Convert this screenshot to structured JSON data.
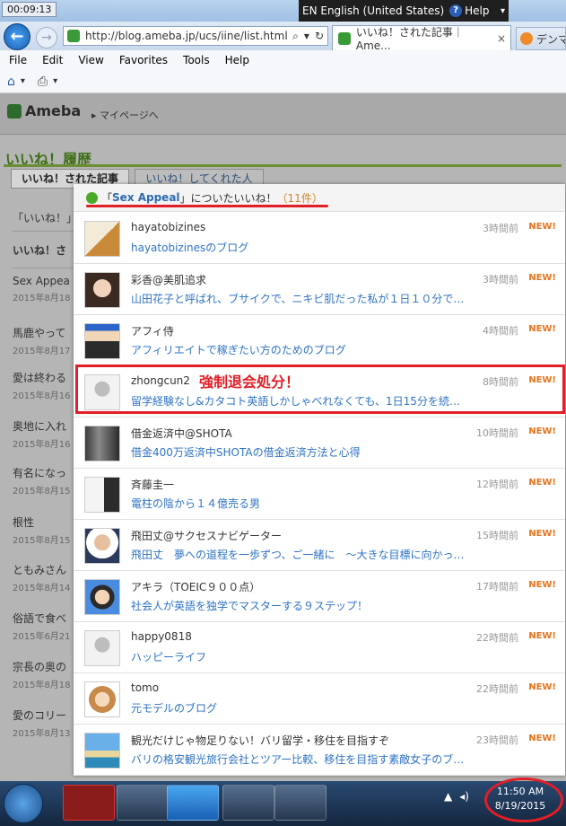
{
  "browser": {
    "timer": "00:09:13",
    "language": "EN English (United States)",
    "help": "Help",
    "address": "http://blog.ameba.jp/ucs/iine/list.html",
    "tabs": [
      {
        "label": "いいね！された記事｜Ame..."
      },
      {
        "label": "デンマ"
      }
    ],
    "menu": [
      "File",
      "Edit",
      "View",
      "Favorites",
      "Tools",
      "Help"
    ]
  },
  "ameba": {
    "logo": "Ameba",
    "mypage": "マイページへ",
    "page_title": "いいね！履歴",
    "tab_received": "いいね！された記事",
    "tab_given": "いいね！してくれた人"
  },
  "left_list": [
    {
      "title": "「いいね！」",
      "date": ""
    },
    {
      "title": "いいね！さ",
      "date": ""
    },
    {
      "title": "Sex Appea",
      "date": "2015年8月18"
    },
    {
      "title": "馬鹿やって",
      "date": "2015年8月17"
    },
    {
      "title": "愛は終わる",
      "date": "2015年8月16"
    },
    {
      "title": "奥地に入れ",
      "date": "2015年8月16"
    },
    {
      "title": "有名になっ",
      "date": "2015年8月15"
    },
    {
      "title": "根性",
      "date": "2015年8月15"
    },
    {
      "title": "ともみさん",
      "date": "2015年8月14"
    },
    {
      "title": "俗語で食べ",
      "date": "2015年6月21"
    },
    {
      "title": "宗長の奥の",
      "date": "2015年8月18"
    },
    {
      "title": "愛のコリー",
      "date": "2015年8月13"
    }
  ],
  "popup": {
    "header_prefix": "「",
    "article": "Sex Appeal",
    "header_suffix": "」についたいいね！",
    "count": "（11件）",
    "items": [
      {
        "name": "hayatobizines",
        "blog": "hayatobizinesのブログ",
        "time": "3時間前",
        "new": "NEW!"
      },
      {
        "name": "彩香@美肌追求",
        "blog": "山田花子と呼ばれ、ブサイクで、ニキビ肌だった私が１日１０分で…",
        "time": "3時間前",
        "new": "NEW!"
      },
      {
        "name": "アフィ侍",
        "blog": "アフィリエイトで稼ぎたい方のためのブログ",
        "time": "4時間前",
        "new": "NEW!"
      },
      {
        "name": "zhongcun2",
        "blog": "留学経験なし&カタコト英語しかしゃべれなくても、1日15分を続…",
        "time": "8時間前",
        "new": "NEW!"
      },
      {
        "name": "借金返済中@SHOTA",
        "blog": "借金400万返済中SHOTAの借金返済方法と心得",
        "time": "10時間前",
        "new": "NEW!"
      },
      {
        "name": "斉藤圭一",
        "blog": "電柱の陰から１４億売る男",
        "time": "12時間前",
        "new": "NEW!"
      },
      {
        "name": "飛田丈@サクセスナビゲーター",
        "blog": "飛田丈　夢への道程を一歩ずつ、ご一緒に　～大きな目標に向かっ…",
        "time": "15時間前",
        "new": "NEW!"
      },
      {
        "name": "アキラ（TOEIC９００点）",
        "blog": "社会人が英語を独学でマスターする９ステップ！",
        "time": "17時間前",
        "new": "NEW!"
      },
      {
        "name": "happy0818",
        "blog": "ハッピーライフ",
        "time": "22時間前",
        "new": "NEW!"
      },
      {
        "name": "tomo",
        "blog": "元モデルのブログ",
        "time": "22時間前",
        "new": "NEW!"
      },
      {
        "name": "観光だけじゃ物足りない！バリ留学・移住を目指すぞ",
        "blog": "バリの格安観光旅行会社とツアー比較、移住を目指す素敵女子のブ…",
        "time": "23時間前",
        "new": "NEW!"
      }
    ],
    "annotation": "強制退会処分！"
  },
  "taskbar": {
    "time": "11:50 AM",
    "date": "8/19/2015"
  }
}
